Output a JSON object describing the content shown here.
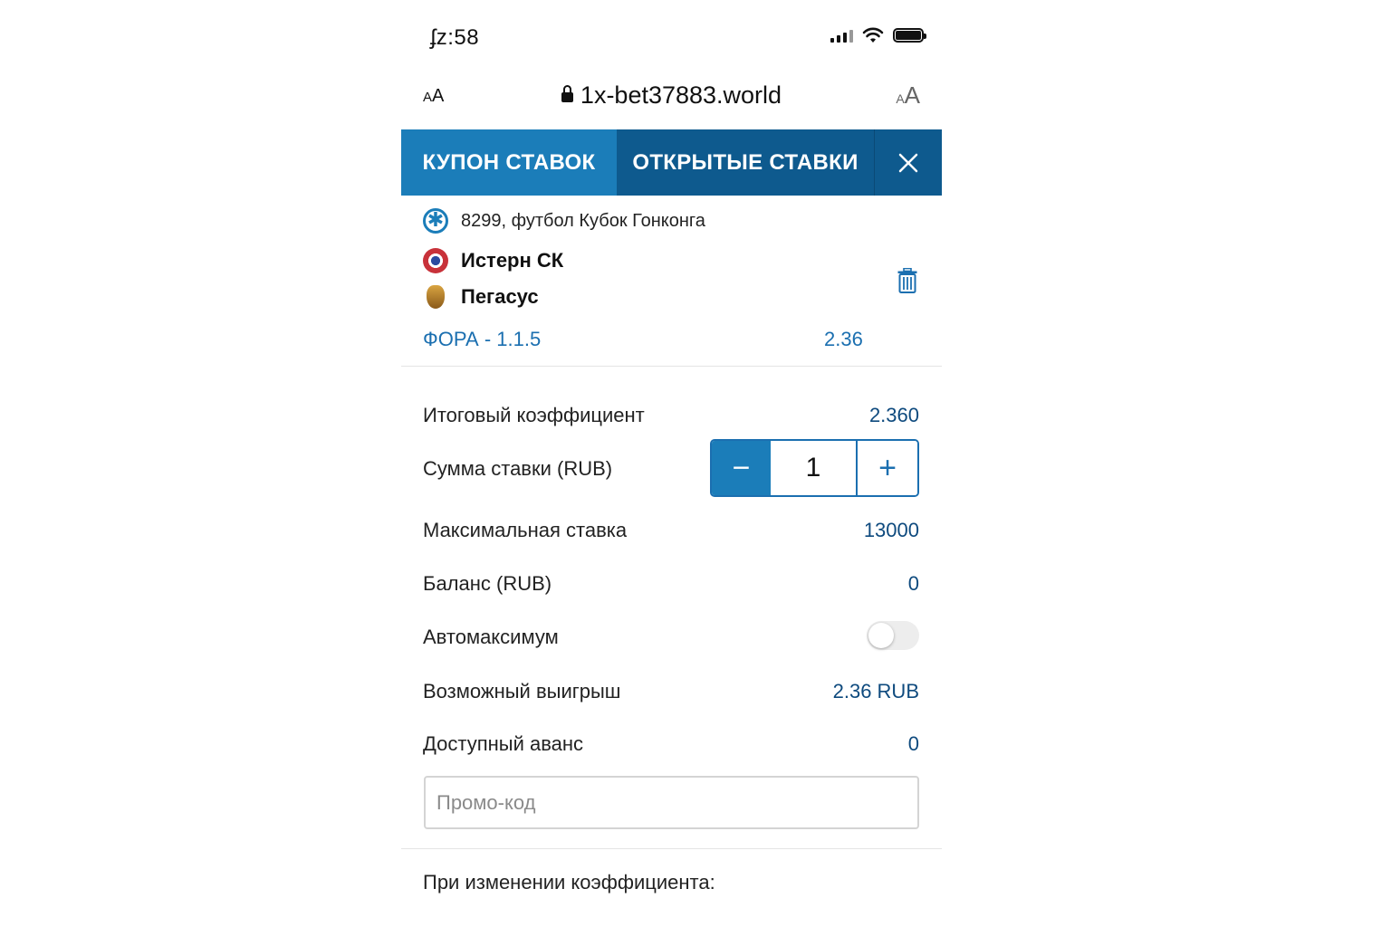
{
  "status_bar": {
    "time": "ʄz:58"
  },
  "browser": {
    "text_size_left": "AA",
    "url": "1x-bet37883.world",
    "text_size_right": "AA"
  },
  "tabs": {
    "coupon": "КУПОН СТАВОК",
    "open_bets": "ОТКРЫТЫЕ СТАВКИ",
    "close": "×"
  },
  "event": {
    "league": "8299, футбол Кубок Гонконга",
    "team1": "Истерн СК",
    "team2": "Пегасус",
    "bet_name": "ФОРА - 1.1.5",
    "bet_odd": "2.36"
  },
  "summary": {
    "total_odds_label": "Итоговый коэффициент",
    "total_odds_value": "2.360",
    "stake_label": "Сумма ставки (RUB)",
    "stake_value": "1",
    "stake_minus": "−",
    "stake_plus": "+",
    "max_bet_label": "Максимальная ставка",
    "max_bet_value": "13000",
    "balance_label": "Баланс (RUB)",
    "balance_value": "0",
    "automax_label": "Автомаксимум",
    "automax_on": false,
    "possible_win_label": "Возможный выигрыш",
    "possible_win_value": "2.36 RUB",
    "advance_label": "Доступный аванс",
    "advance_value": "0",
    "promo_placeholder": "Промо-код",
    "odds_change_label": "При изменении коэффициента:"
  },
  "colors": {
    "tab_active": "#1b7db9",
    "tab_inactive": "#0e5a8e",
    "accent_text": "#1b6fb0",
    "value_text": "#0e4a7e"
  }
}
